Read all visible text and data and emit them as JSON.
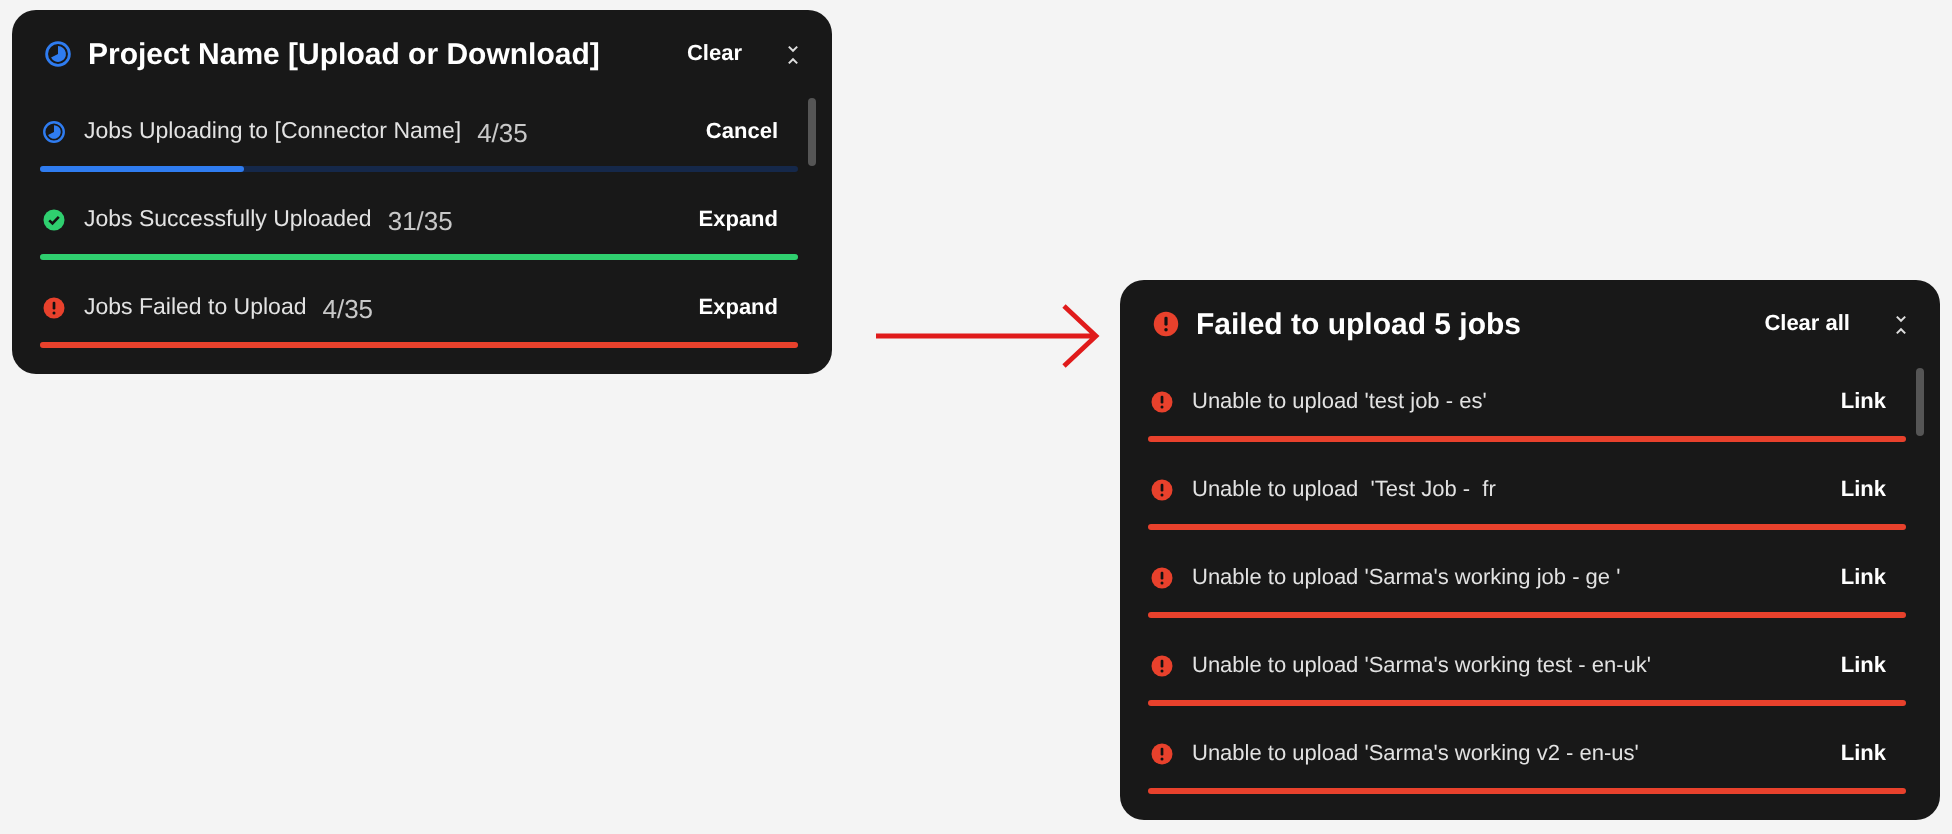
{
  "upload_panel": {
    "title": "Project Name [Upload or Download]",
    "clear": "Clear",
    "jobs": [
      {
        "kind": "uploading",
        "label": "Jobs Uploading to [Connector Name]",
        "count": "4/35",
        "action": "Cancel",
        "level": 0.27
      },
      {
        "kind": "success",
        "label": "Jobs Successfully Uploaded",
        "count": "31/35",
        "action": "Expand",
        "level": 1
      },
      {
        "kind": "failed",
        "label": "Jobs Failed to Upload",
        "count": "4/35",
        "action": "Expand",
        "level": 1
      }
    ]
  },
  "failed_panel": {
    "title": "Failed to upload 5 jobs",
    "clear": "Clear all",
    "items": [
      {
        "message": "Unable to upload 'test job - es'",
        "action": "Link"
      },
      {
        "message": "Unable to upload  'Test Job -  fr",
        "action": "Link"
      },
      {
        "message": "Unable to upload 'Sarma's working job - ge '",
        "action": "Link"
      },
      {
        "message": "Unable to upload 'Sarma's working test - en-uk'",
        "action": "Link"
      },
      {
        "message": "Unable to upload 'Sarma's working v2 - en-us'",
        "action": "Link"
      }
    ]
  }
}
